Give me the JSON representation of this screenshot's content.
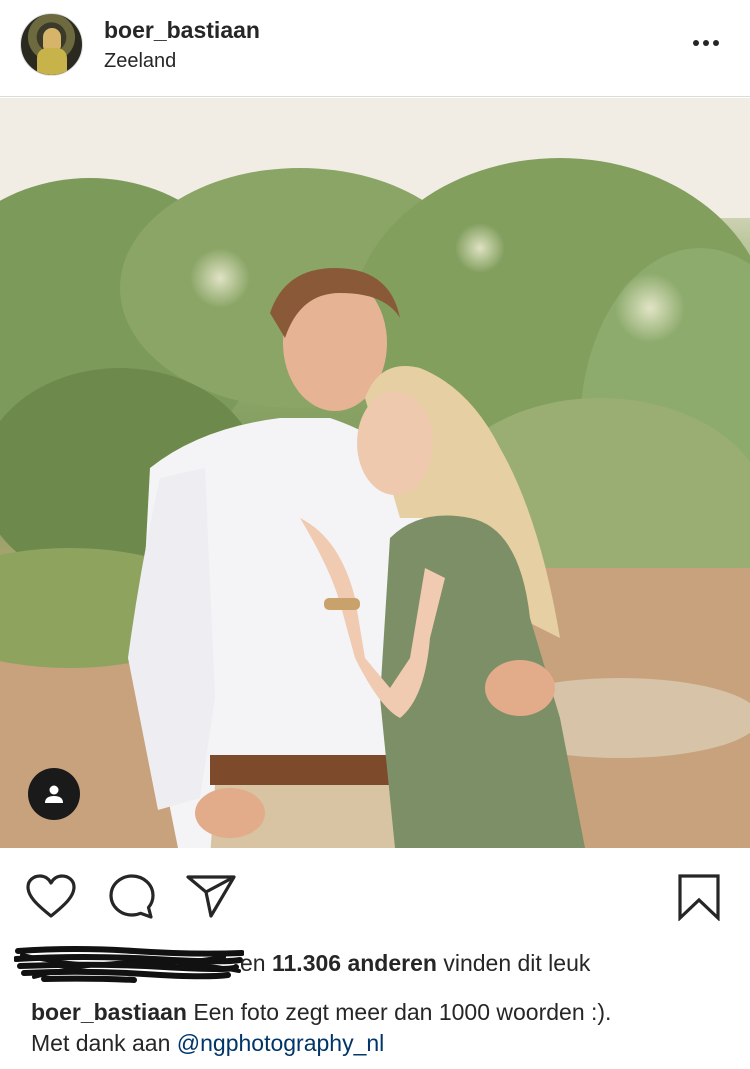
{
  "post": {
    "username": "boer_bastiaan",
    "location": "Zeeland",
    "likes": {
      "prefix": "en",
      "count": "11.306 anderen",
      "suffix": "vinden dit leuk"
    },
    "caption": {
      "username": "boer_bastiaan",
      "text_line1": "Een foto zegt meer dan 1000 woorden :).",
      "text_line2_prefix": "Met dank aan",
      "mention": "@ngphotography_nl"
    }
  },
  "icons": {
    "more": "more-horizontal-icon",
    "like": "heart-icon",
    "comment": "comment-bubble-icon",
    "share": "paper-plane-icon",
    "save": "bookmark-icon",
    "tag": "user-tag-icon"
  },
  "colors": {
    "text": "#262626",
    "mention": "#003569",
    "divider": "#dbdbdb"
  }
}
